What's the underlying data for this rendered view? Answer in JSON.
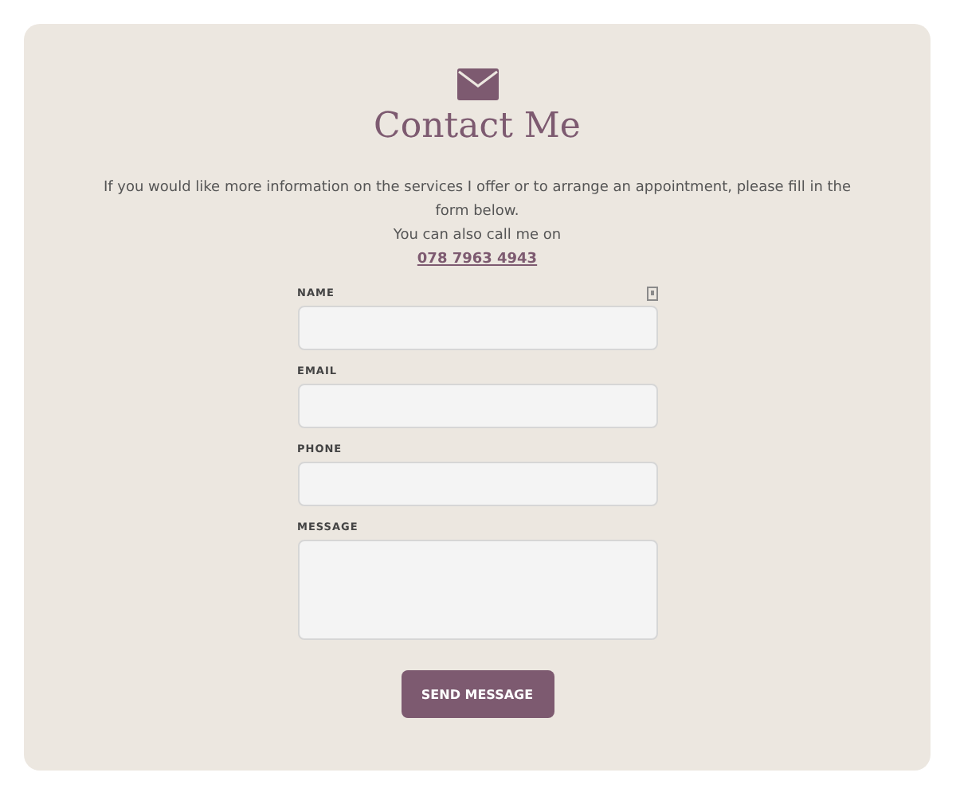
{
  "heading": "Contact Me",
  "intro": "If you would like more information on the services I offer or to arrange an appointment, please fill in the form below.",
  "call_line": "You can also call me on",
  "phone_link": "078 7963 4943",
  "fields": [
    {
      "label": "NAME",
      "kind": "input",
      "autofill_icon": true
    },
    {
      "label": "EMAIL",
      "kind": "input"
    },
    {
      "label": "PHONE",
      "kind": "input"
    },
    {
      "label": "MESSAGE",
      "kind": "textarea"
    }
  ],
  "submit": "SEND MESSAGE"
}
